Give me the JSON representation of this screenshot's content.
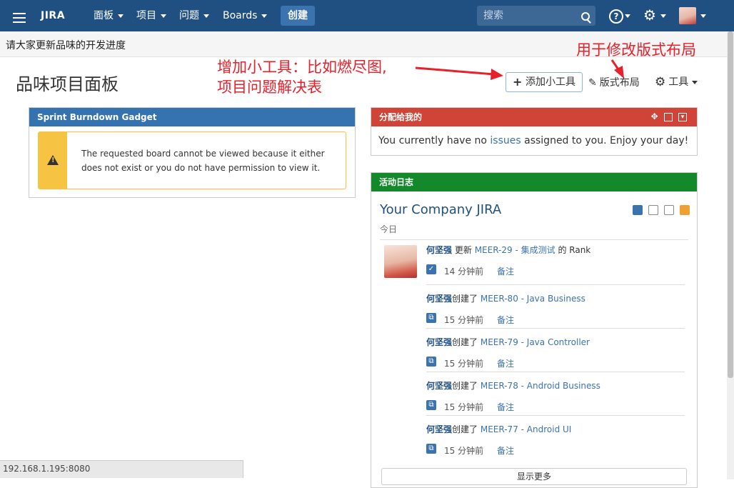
{
  "nav": {
    "logo": "JIRA",
    "menu": [
      "面板",
      "项目",
      "问题",
      "Boards"
    ],
    "create": "创建",
    "search_placeholder": "搜索"
  },
  "announcement": "请大家更新品味的开发进度",
  "page_title": "品味项目面板",
  "annotations": {
    "add_gadget_note_line1": "增加小工具：比如燃尽图,",
    "add_gadget_note_line2": "项目问题解决表",
    "layout_note": "用于修改版式布局"
  },
  "toolbar": {
    "add_gadget": "添加小工具",
    "edit_layout": "版式布局",
    "tools": "工具"
  },
  "gadget_burndown": {
    "title": "Sprint Burndown Gadget",
    "message": "The requested board cannot be viewed because it either does not exist or you do not have permission to view it."
  },
  "gadget_assigned": {
    "title": "分配给我的",
    "text_before": "You currently have no ",
    "link": "issues",
    "text_after": " assigned to you. Enjoy your day!"
  },
  "gadget_activity": {
    "title": "活动日志",
    "stream_title": "Your Company JIRA",
    "today": "今日",
    "entries": [
      {
        "user": "何坚强",
        "verb": "更新",
        "link": "MEER-29 - 集成测试",
        "suffix": "的 Rank",
        "time": "14 分钟前",
        "comment": "备注"
      },
      {
        "user": "何坚强",
        "verb": "创建了",
        "link": "MEER-80 - Java Business",
        "suffix": "",
        "time": "15 分钟前",
        "comment": "备注"
      },
      {
        "user": "何坚强",
        "verb": "创建了",
        "link": "MEER-79 - Java Controller",
        "suffix": "",
        "time": "15 分钟前",
        "comment": "备注"
      },
      {
        "user": "何坚强",
        "verb": "创建了",
        "link": "MEER-78 - Android Business",
        "suffix": "",
        "time": "15 分钟前",
        "comment": "备注"
      },
      {
        "user": "何坚强",
        "verb": "创建了",
        "link": "MEER-77 - Android UI",
        "suffix": "",
        "time": "15 分钟前",
        "comment": "备注"
      }
    ],
    "more": "显示更多"
  },
  "status_url": "192.168.1.195:8080"
}
